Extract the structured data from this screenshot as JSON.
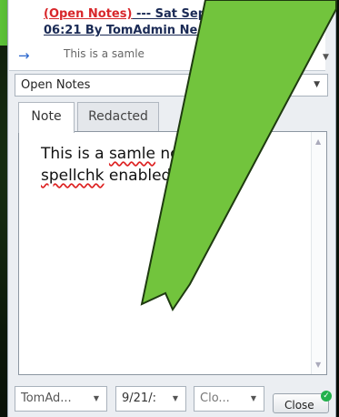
{
  "note": {
    "tag": "(Open Notes)",
    "header_rest": " --- Sat Sep",
    "header_time_frag": "@",
    "line2": "06:21 By TomAdmin Ne",
    "preview": "This is a samle"
  },
  "notes_select": {
    "value": "Open Notes"
  },
  "tabs": {
    "note": "Note",
    "redacted": "Redacted"
  },
  "editor": {
    "p1": "This is a ",
    "w1": "samle",
    "p2": " note with ",
    "w2": "spellchk",
    "p3": " enabled."
  },
  "footer": {
    "user": "TomAd...",
    "date": "9/21/:",
    "status": "Clo...",
    "close_label": "Close"
  },
  "colors": {
    "accent": "#5cc238",
    "tag_red": "#d8262a",
    "link_navy": "#1a2a55"
  }
}
